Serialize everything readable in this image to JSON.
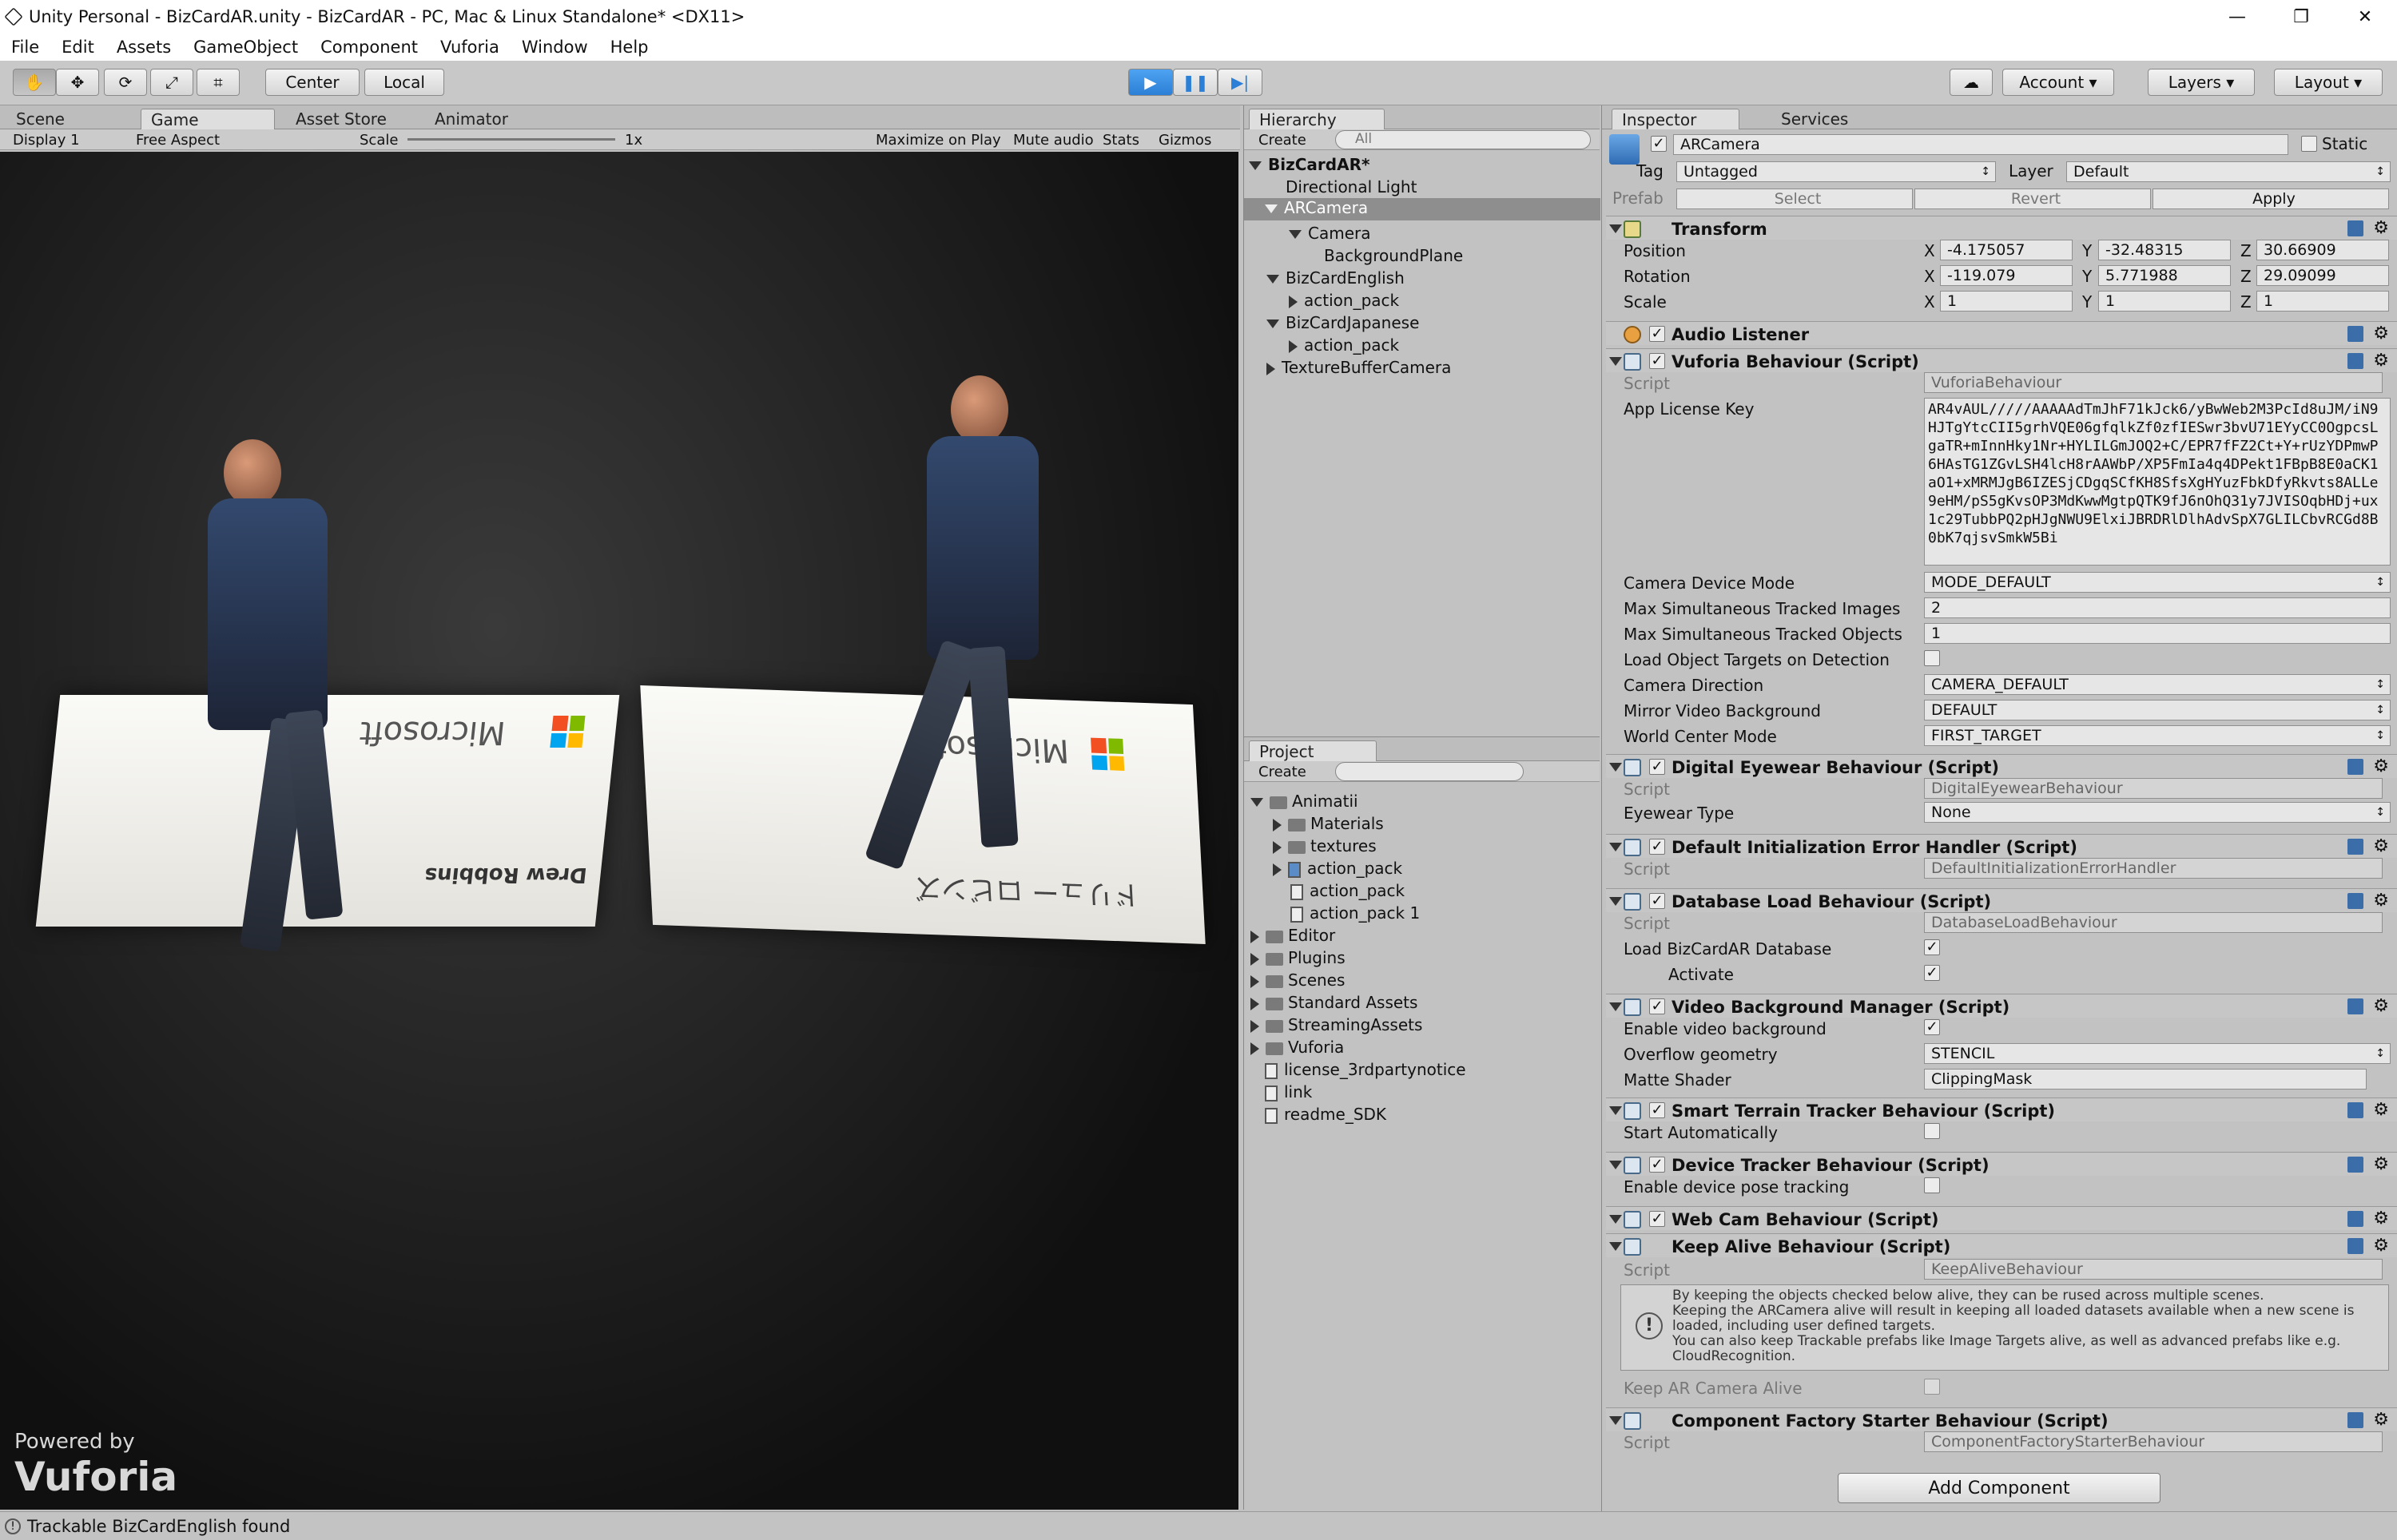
{
  "window": {
    "title": "Unity Personal - BizCardAR.unity - BizCardAR - PC, Mac & Linux Standalone* <DX11>",
    "controls": [
      "—",
      "❐",
      "✕"
    ]
  },
  "menu": [
    "File",
    "Edit",
    "Assets",
    "GameObject",
    "Component",
    "Vuforia",
    "Window",
    "Help"
  ],
  "toolbar": {
    "center": "Center",
    "local": "Local",
    "account": "Account",
    "layers": "Layers",
    "layout": "Layout"
  },
  "game": {
    "tabs": [
      "Scene",
      "Game",
      "Asset Store",
      "Animator"
    ],
    "display": "Display 1",
    "aspect": "Free Aspect",
    "scale_label": "Scale",
    "scale_value": "1x",
    "buttons": [
      "Maximize on Play",
      "Mute audio",
      "Stats",
      "Gizmos"
    ],
    "card_left_name": "Drew Robbins",
    "card_right_name": "ドリュー ロビンズ",
    "logo_text": "Microsoft",
    "powered_by": "Powered by",
    "vuforia": "Vuforia"
  },
  "hierarchy": {
    "tab": "Hierarchy",
    "create": "Create",
    "search_placeholder": "All",
    "scene": "BizCardAR*",
    "items": [
      "Directional Light",
      "ARCamera",
      "Camera",
      "BackgroundPlane",
      "BizCardEnglish",
      "action_pack",
      "BizCardJapanese",
      "action_pack",
      "TextureBufferCamera"
    ]
  },
  "project": {
    "tab": "Project",
    "create": "Create",
    "items": [
      "Animatii",
      "Materials",
      "textures",
      "action_pack",
      "action_pack",
      "action_pack 1",
      "Editor",
      "Plugins",
      "Scenes",
      "Standard Assets",
      "StreamingAssets",
      "Vuforia",
      "license_3rdpartynotice",
      "link",
      "readme_SDK"
    ]
  },
  "inspector": {
    "tabs": [
      "Inspector",
      "Services"
    ],
    "object_name": "ARCamera",
    "static_label": "Static",
    "tag_label": "Tag",
    "tag_value": "Untagged",
    "layer_label": "Layer",
    "layer_value": "Default",
    "prefab_label": "Prefab",
    "prefab_buttons": [
      "Select",
      "Revert",
      "Apply"
    ],
    "transform": {
      "title": "Transform",
      "position_label": "Position",
      "position": [
        "-4.175057",
        "-32.48315",
        "30.66909"
      ],
      "rotation_label": "Rotation",
      "rotation": [
        "-119.079",
        "5.771988",
        "29.09099"
      ],
      "scale_label": "Scale",
      "scale": [
        "1",
        "1",
        "1"
      ],
      "axes": [
        "X",
        "Y",
        "Z"
      ]
    },
    "audio_listener": "Audio Listener",
    "vuforia_behaviour": {
      "title": "Vuforia Behaviour (Script)",
      "script_label": "Script",
      "script": "VuforiaBehaviour",
      "license_label": "App License Key",
      "license": "AR4vAUL/////AAAAAdTmJhF71kJck6/yBwWeb2M3PcId8uJM/iN9HJTgYtcCII5grhVQE06gfqlkZf0zfIESwr3bvU71EYyCC0OgpcsLgaTR+mInnHky1Nr+HYLILGmJOQ2+C/EPR7fFZ2Ct+Y+rUzYDPmwP6HAsTG1ZGvLSH4lcH8rAAWbP/XP5FmIa4q4DPekt1FBpB8E0aCK1aO1+xMRMJgB6IZESjCDgqSCfKH8SfsXgHYuzFbkDfyRkvts8ALLe9eHM/pS5gKvsOP3MdKwwMgtpQTK9fJ6nOhQ31y7JVISOqbHDj+ux1c29TubbPQ2pHJgNWU9ElxiJBRDRlDlhAdvSpX7GLILCbvRCGd8B0bK7qjsvSmkW5Bi",
      "fields": [
        {
          "label": "Camera Device Mode",
          "value": "MODE_DEFAULT"
        },
        {
          "label": "Max Simultaneous Tracked Images",
          "value": "2"
        },
        {
          "label": "Max Simultaneous Tracked Objects",
          "value": "1"
        },
        {
          "label": "Load Object Targets on Detection",
          "value": ""
        },
        {
          "label": "Camera Direction",
          "value": "CAMERA_DEFAULT"
        },
        {
          "label": "Mirror Video Background",
          "value": "DEFAULT"
        },
        {
          "label": "World Center Mode",
          "value": "FIRST_TARGET"
        }
      ]
    },
    "digital_eyewear": {
      "title": "Digital Eyewear Behaviour (Script)",
      "script": "DigitalEyewearBehaviour",
      "eyewear_label": "Eyewear Type",
      "eyewear_value": "None"
    },
    "default_init": {
      "title": "Default Initialization Error Handler (Script)",
      "script": "DefaultInitializationErrorHandler"
    },
    "database_load": {
      "title": "Database Load Behaviour (Script)",
      "script": "DatabaseLoadBehaviour",
      "load_label": "Load BizCardAR Database",
      "activate_label": "Activate"
    },
    "video_bg": {
      "title": "Video Background Manager (Script)",
      "enable_label": "Enable video background",
      "overflow_label": "Overflow geometry",
      "overflow_value": "STENCIL",
      "matte_label": "Matte Shader",
      "matte_value": "ClippingMask"
    },
    "smart_terrain": {
      "title": "Smart Terrain Tracker Behaviour (Script)",
      "start_label": "Start Automatically"
    },
    "device_tracker": {
      "title": "Device Tracker Behaviour (Script)",
      "pose_label": "Enable device pose tracking"
    },
    "webcam": {
      "title": "Web Cam Behaviour (Script)"
    },
    "keep_alive": {
      "title": "Keep Alive Behaviour (Script)",
      "script": "KeepAliveBehaviour",
      "info": [
        "By keeping the objects checked below alive, they can be rused across multiple scenes.",
        "Keeping the ARCamera alive will result in keeping all loaded datasets available when a new scene is loaded, including user defined targets.",
        "You can also keep Trackable prefabs like Image Targets alive, as well as advanced prefabs like e.g. CloudRecognition."
      ],
      "keep_label": "Keep AR Camera Alive"
    },
    "component_factory": {
      "title": "Component Factory Starter Behaviour (Script)",
      "script": "ComponentFactoryStarterBehaviour"
    },
    "add_component": "Add Component"
  },
  "status": {
    "message": "Trackable BizCardEnglish found"
  },
  "colors": {
    "accent_play": "#3a8ee6",
    "selection": "#8e8e8e"
  }
}
